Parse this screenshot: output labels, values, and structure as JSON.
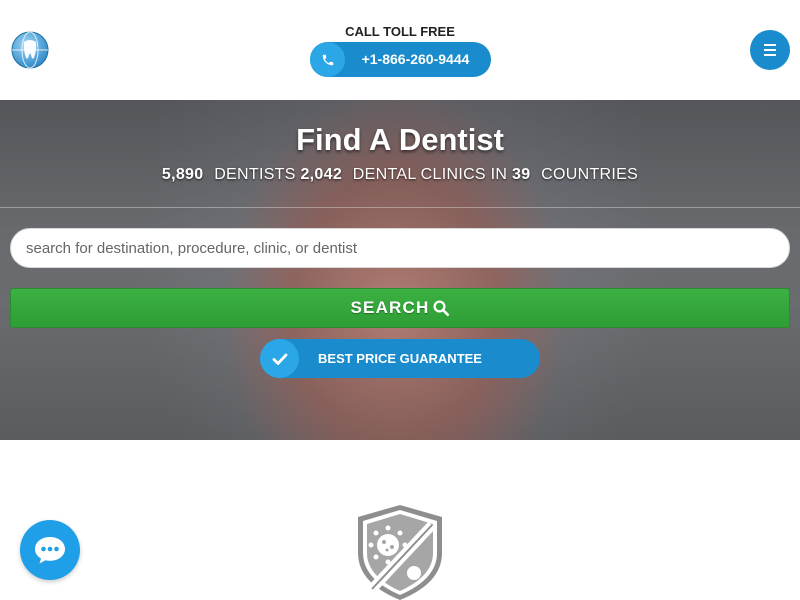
{
  "header": {
    "call_label": "CALL TOLL FREE",
    "phone_number": "+1-866-260-9444",
    "accent_color": "#1a8ccd",
    "icons": {
      "logo": "globe-tooth-logo",
      "phone": "phone-icon",
      "menu": "hamburger-menu-icon"
    }
  },
  "hero": {
    "title": "Find A Dentist",
    "stats": {
      "dentists_count": "5,890",
      "dentists_label": "DENTISTS",
      "clinics_count": "2,042",
      "clinics_label": "DENTAL CLINICS IN",
      "countries_count": "39",
      "countries_label": "COUNTRIES"
    },
    "search": {
      "placeholder": "search for destination, procedure, clinic, or dentist",
      "button_label": "SEARCH",
      "button_color": "#3cb043"
    },
    "guarantee_label": "BEST PRICE GUARANTEE"
  },
  "badges": {
    "shield_icon": "covid-19-trust-shield-icon",
    "chat_icon": "chat-bubble-icon"
  }
}
